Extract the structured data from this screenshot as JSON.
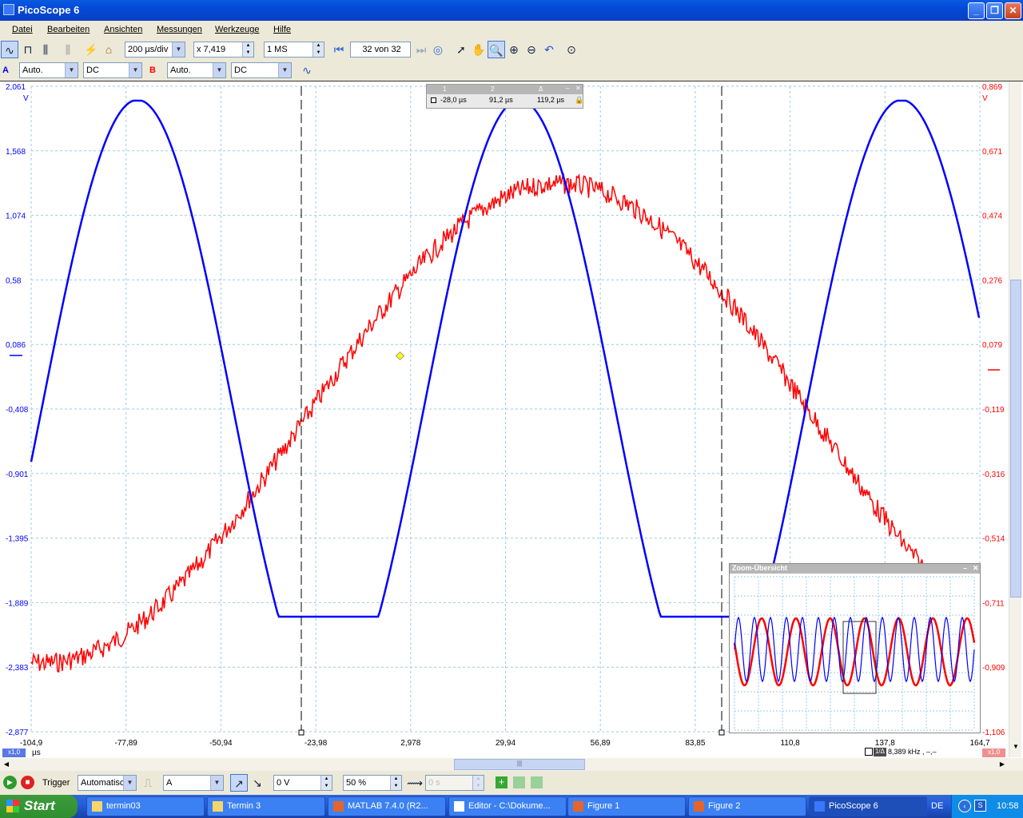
{
  "window": {
    "title": "PicoScope 6"
  },
  "menu": [
    "Datei",
    "Bearbeiten",
    "Ansichten",
    "Messungen",
    "Werkzeuge",
    "Hilfe"
  ],
  "toolbar": {
    "timebase": "200 µs/div",
    "zoom": "x 7,419",
    "samples": "1 MS",
    "buffer_pos": "32",
    "buffer_sep": "von",
    "buffer_total": "32"
  },
  "channels": {
    "a_label": "A",
    "a_range": "Auto.",
    "a_coupling": "DC",
    "b_label": "B",
    "b_range": "Auto.",
    "b_coupling": "DC"
  },
  "scope": {
    "left_ticks": [
      "2,061",
      "1,568",
      "1,074",
      "0,58",
      "0,086",
      "-0,408",
      "-0,901",
      "-1,395",
      "-1,889",
      "-2,383",
      "-2,877"
    ],
    "right_ticks": [
      "0,869",
      "0,671",
      "0,474",
      "0,276",
      "0,079",
      "-0,119",
      "-0,316",
      "-0,514",
      "-0,711",
      "-0,909",
      "-1,106"
    ],
    "left_unit": "V",
    "right_unit": "V",
    "x_ticks": [
      "-104,9",
      "-77,89",
      "-50,94",
      "-23,98",
      "2,978",
      "29,94",
      "56,89",
      "83,85",
      "110,8",
      "137,8",
      "164,7"
    ],
    "x_unit": "µs",
    "x_scale_badge": "x1,0",
    "right_scale_badge": "x1,0",
    "ruler_readout": "8,389 kHz , –,–",
    "ruler_badge": "1/Δ",
    "colors": {
      "channel_a": "#0000ff",
      "channel_b": "#ff0000",
      "grid": "#9ecbe6"
    }
  },
  "ruler_panel": {
    "col1": "1",
    "col2": "2",
    "col3": "Δ",
    "val1": "-28,0 µs",
    "val2": "91,2 µs",
    "val3": "119,2 µs"
  },
  "zoom_overview": {
    "title": "Zoom-Übersicht"
  },
  "trigger": {
    "label": "Trigger",
    "mode": "Automatisch",
    "source": "A",
    "threshold": "0 V",
    "position": "50 %",
    "delay": "0 s"
  },
  "taskbar": {
    "start": "Start",
    "items": [
      "termin03",
      "Termin 3",
      "MATLAB  7.4.0 (R2...",
      "Editor - C:\\Dokume...",
      "Figure 1",
      "Figure 2",
      "PicoScope 6"
    ],
    "lang": "DE",
    "clock": "10:58"
  }
}
